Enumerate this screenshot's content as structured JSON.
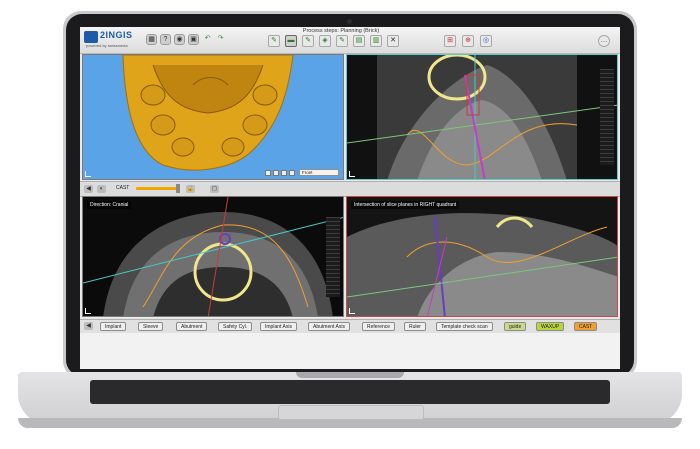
{
  "app": {
    "logo_text": "2INGIS",
    "logo_subtext": "powered by swissmeda",
    "process_title": "Process steps: Planning (Brick)"
  },
  "toolbar": {
    "left_icons": [
      "grid-icon",
      "help-icon",
      "camera-icon",
      "screenshot-icon",
      "undo-icon",
      "redo-icon"
    ],
    "step_icons": [
      "step-1-icon",
      "step-2-icon",
      "step-3-icon",
      "step-4-icon",
      "step-5-icon",
      "step-6-icon",
      "step-7-icon",
      "close-x-icon"
    ],
    "right_icons": [
      "view-layout-1-icon",
      "view-layout-2-icon",
      "view-layout-3-icon",
      "chat-icon"
    ]
  },
  "views": {
    "three_d": {
      "view_option": "Front",
      "model_color": "#e0a41a",
      "background": "#5aa3e6"
    },
    "coronal": {
      "label": ""
    },
    "axial": {
      "label": "Direction: Cranial"
    },
    "sagittal": {
      "label": "Intersection of slice planes in RIGHT quadrant"
    }
  },
  "midbar": {
    "cast_label": "CAST",
    "slider_color": "#f0a800"
  },
  "bottombar": {
    "buttons": [
      {
        "label": "Implant"
      },
      {
        "label": "Sleeve"
      },
      {
        "label": "Abutment"
      },
      {
        "label": "Safety Cyl."
      },
      {
        "label": "Implant Axis"
      },
      {
        "label": "Abutment Axis"
      },
      {
        "label": "Reference"
      },
      {
        "label": "Ruler"
      },
      {
        "label": "Template check scan"
      },
      {
        "label": "guide"
      },
      {
        "label": "WAXUP"
      },
      {
        "label": "CAST"
      }
    ]
  }
}
